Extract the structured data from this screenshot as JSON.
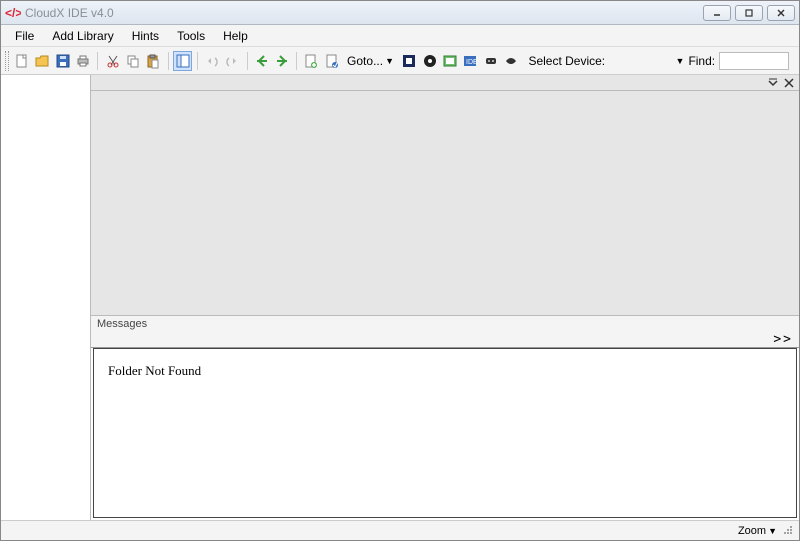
{
  "titlebar": {
    "title": "CloudX IDE v4.0"
  },
  "menubar": {
    "items": [
      "File",
      "Add Library",
      "Hints",
      "Tools",
      "Help"
    ]
  },
  "toolbar": {
    "goto_label": "Goto...",
    "select_device_label": "Select Device:",
    "find_label": "Find:"
  },
  "panels": {
    "messages_label": "Messages",
    "messages_expand": ">>",
    "messages_text": "Folder Not Found"
  },
  "statusbar": {
    "zoom_label": "Zoom"
  }
}
